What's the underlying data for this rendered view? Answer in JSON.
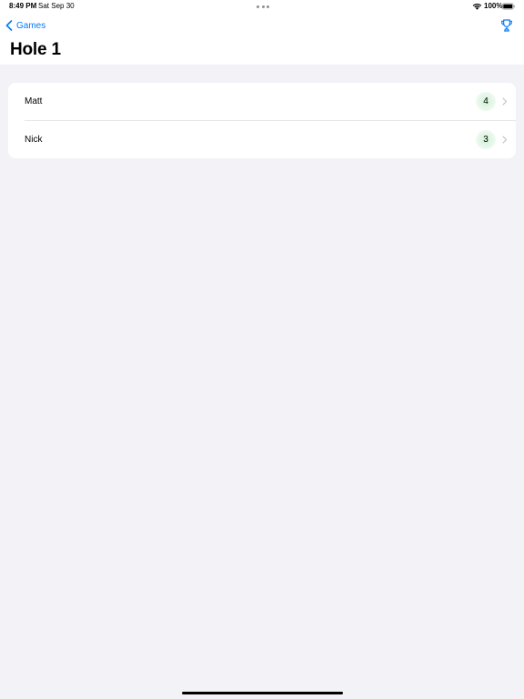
{
  "status_bar": {
    "time": "8:49 PM",
    "date": "Sat Sep 30",
    "battery": "100%"
  },
  "nav": {
    "back_label": "Games",
    "title": "Hole 1"
  },
  "rows": [
    {
      "name": "Matt",
      "score": "4"
    },
    {
      "name": "Nick",
      "score": "3"
    }
  ],
  "colors": {
    "accent": "#007aff",
    "background": "#f2f2f7",
    "badge": "#d2f1d8"
  },
  "icons": {
    "back": "chevron-left-icon",
    "trophy": "trophy-icon",
    "row_disclosure": "chevron-right-icon"
  }
}
